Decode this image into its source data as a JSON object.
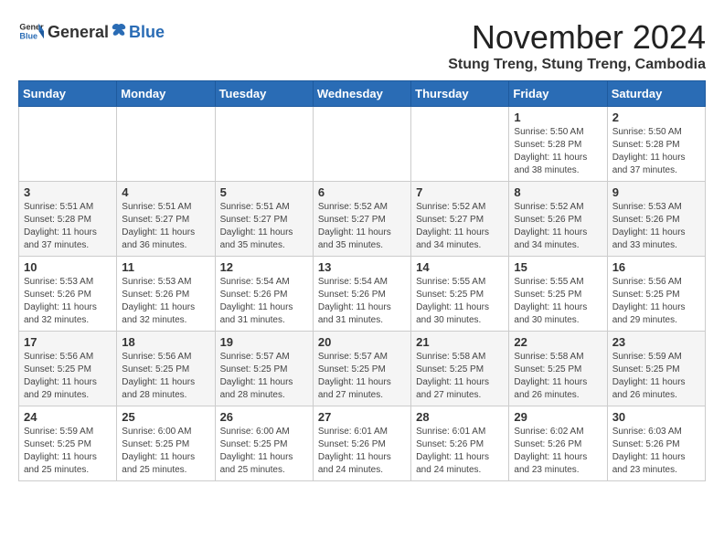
{
  "header": {
    "logo_general": "General",
    "logo_blue": "Blue",
    "month": "November 2024",
    "location": "Stung Treng, Stung Treng, Cambodia"
  },
  "weekdays": [
    "Sunday",
    "Monday",
    "Tuesday",
    "Wednesday",
    "Thursday",
    "Friday",
    "Saturday"
  ],
  "weeks": [
    [
      {
        "day": "",
        "info": ""
      },
      {
        "day": "",
        "info": ""
      },
      {
        "day": "",
        "info": ""
      },
      {
        "day": "",
        "info": ""
      },
      {
        "day": "",
        "info": ""
      },
      {
        "day": "1",
        "info": "Sunrise: 5:50 AM\nSunset: 5:28 PM\nDaylight: 11 hours and 38 minutes."
      },
      {
        "day": "2",
        "info": "Sunrise: 5:50 AM\nSunset: 5:28 PM\nDaylight: 11 hours and 37 minutes."
      }
    ],
    [
      {
        "day": "3",
        "info": "Sunrise: 5:51 AM\nSunset: 5:28 PM\nDaylight: 11 hours and 37 minutes."
      },
      {
        "day": "4",
        "info": "Sunrise: 5:51 AM\nSunset: 5:27 PM\nDaylight: 11 hours and 36 minutes."
      },
      {
        "day": "5",
        "info": "Sunrise: 5:51 AM\nSunset: 5:27 PM\nDaylight: 11 hours and 35 minutes."
      },
      {
        "day": "6",
        "info": "Sunrise: 5:52 AM\nSunset: 5:27 PM\nDaylight: 11 hours and 35 minutes."
      },
      {
        "day": "7",
        "info": "Sunrise: 5:52 AM\nSunset: 5:27 PM\nDaylight: 11 hours and 34 minutes."
      },
      {
        "day": "8",
        "info": "Sunrise: 5:52 AM\nSunset: 5:26 PM\nDaylight: 11 hours and 34 minutes."
      },
      {
        "day": "9",
        "info": "Sunrise: 5:53 AM\nSunset: 5:26 PM\nDaylight: 11 hours and 33 minutes."
      }
    ],
    [
      {
        "day": "10",
        "info": "Sunrise: 5:53 AM\nSunset: 5:26 PM\nDaylight: 11 hours and 32 minutes."
      },
      {
        "day": "11",
        "info": "Sunrise: 5:53 AM\nSunset: 5:26 PM\nDaylight: 11 hours and 32 minutes."
      },
      {
        "day": "12",
        "info": "Sunrise: 5:54 AM\nSunset: 5:26 PM\nDaylight: 11 hours and 31 minutes."
      },
      {
        "day": "13",
        "info": "Sunrise: 5:54 AM\nSunset: 5:26 PM\nDaylight: 11 hours and 31 minutes."
      },
      {
        "day": "14",
        "info": "Sunrise: 5:55 AM\nSunset: 5:25 PM\nDaylight: 11 hours and 30 minutes."
      },
      {
        "day": "15",
        "info": "Sunrise: 5:55 AM\nSunset: 5:25 PM\nDaylight: 11 hours and 30 minutes."
      },
      {
        "day": "16",
        "info": "Sunrise: 5:56 AM\nSunset: 5:25 PM\nDaylight: 11 hours and 29 minutes."
      }
    ],
    [
      {
        "day": "17",
        "info": "Sunrise: 5:56 AM\nSunset: 5:25 PM\nDaylight: 11 hours and 29 minutes."
      },
      {
        "day": "18",
        "info": "Sunrise: 5:56 AM\nSunset: 5:25 PM\nDaylight: 11 hours and 28 minutes."
      },
      {
        "day": "19",
        "info": "Sunrise: 5:57 AM\nSunset: 5:25 PM\nDaylight: 11 hours and 28 minutes."
      },
      {
        "day": "20",
        "info": "Sunrise: 5:57 AM\nSunset: 5:25 PM\nDaylight: 11 hours and 27 minutes."
      },
      {
        "day": "21",
        "info": "Sunrise: 5:58 AM\nSunset: 5:25 PM\nDaylight: 11 hours and 27 minutes."
      },
      {
        "day": "22",
        "info": "Sunrise: 5:58 AM\nSunset: 5:25 PM\nDaylight: 11 hours and 26 minutes."
      },
      {
        "day": "23",
        "info": "Sunrise: 5:59 AM\nSunset: 5:25 PM\nDaylight: 11 hours and 26 minutes."
      }
    ],
    [
      {
        "day": "24",
        "info": "Sunrise: 5:59 AM\nSunset: 5:25 PM\nDaylight: 11 hours and 25 minutes."
      },
      {
        "day": "25",
        "info": "Sunrise: 6:00 AM\nSunset: 5:25 PM\nDaylight: 11 hours and 25 minutes."
      },
      {
        "day": "26",
        "info": "Sunrise: 6:00 AM\nSunset: 5:25 PM\nDaylight: 11 hours and 25 minutes."
      },
      {
        "day": "27",
        "info": "Sunrise: 6:01 AM\nSunset: 5:26 PM\nDaylight: 11 hours and 24 minutes."
      },
      {
        "day": "28",
        "info": "Sunrise: 6:01 AM\nSunset: 5:26 PM\nDaylight: 11 hours and 24 minutes."
      },
      {
        "day": "29",
        "info": "Sunrise: 6:02 AM\nSunset: 5:26 PM\nDaylight: 11 hours and 23 minutes."
      },
      {
        "day": "30",
        "info": "Sunrise: 6:03 AM\nSunset: 5:26 PM\nDaylight: 11 hours and 23 minutes."
      }
    ]
  ]
}
